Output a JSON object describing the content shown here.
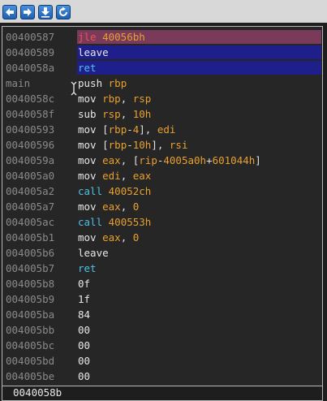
{
  "toolbar": {
    "buttons": [
      {
        "name": "back",
        "icon": "arrow-left-icon"
      },
      {
        "name": "forward",
        "icon": "arrow-right-icon"
      },
      {
        "name": "step-into",
        "icon": "step-into-icon"
      },
      {
        "name": "refresh",
        "icon": "refresh-icon"
      }
    ]
  },
  "listing": {
    "rows": [
      {
        "addr": "00400587",
        "mnemonic": "jle",
        "operands": "40056bh"
      },
      {
        "addr": "00400589",
        "mnemonic": "leave",
        "operands": ""
      },
      {
        "addr": "0040058a",
        "mnemonic": "ret",
        "operands": ""
      },
      {
        "addr": "main",
        "mnemonic": "push",
        "operands": "rbp"
      },
      {
        "addr": "0040058c",
        "mnemonic": "mov",
        "operands": "rbp, rsp"
      },
      {
        "addr": "0040058f",
        "mnemonic": "sub",
        "operands": "rsp, 10h"
      },
      {
        "addr": "00400593",
        "mnemonic": "mov",
        "operands": "[rbp-4], edi"
      },
      {
        "addr": "00400596",
        "mnemonic": "mov",
        "operands": "[rbp-10h], rsi"
      },
      {
        "addr": "0040059a",
        "mnemonic": "mov",
        "operands": "eax, [rip-4005a0h+601044h]"
      },
      {
        "addr": "004005a0",
        "mnemonic": "mov",
        "operands": "edi, eax"
      },
      {
        "addr": "004005a2",
        "mnemonic": "call",
        "operands": "40052ch"
      },
      {
        "addr": "004005a7",
        "mnemonic": "mov",
        "operands": "eax, 0"
      },
      {
        "addr": "004005ac",
        "mnemonic": "call",
        "operands": "400553h"
      },
      {
        "addr": "004005b1",
        "mnemonic": "mov",
        "operands": "eax, 0"
      },
      {
        "addr": "004005b6",
        "mnemonic": "leave",
        "operands": ""
      },
      {
        "addr": "004005b7",
        "mnemonic": "ret",
        "operands": ""
      },
      {
        "addr": "004005b8",
        "mnemonic": "0f",
        "operands": ""
      },
      {
        "addr": "004005b9",
        "mnemonic": "1f",
        "operands": ""
      },
      {
        "addr": "004005ba",
        "mnemonic": "84",
        "operands": ""
      },
      {
        "addr": "004005bb",
        "mnemonic": "00",
        "operands": ""
      },
      {
        "addr": "004005bc",
        "mnemonic": "00",
        "operands": ""
      },
      {
        "addr": "004005bd",
        "mnemonic": "00",
        "operands": ""
      },
      {
        "addr": "004005be",
        "mnemonic": "00",
        "operands": ""
      }
    ]
  },
  "status": {
    "address": "0040058b"
  },
  "colors": {
    "highlight_red": "#7a3a5a",
    "highlight_blue": "#1f1f8c",
    "address": "#8a8a8a",
    "operand": "#e8a030",
    "call_ret": "#4fc0e8"
  }
}
